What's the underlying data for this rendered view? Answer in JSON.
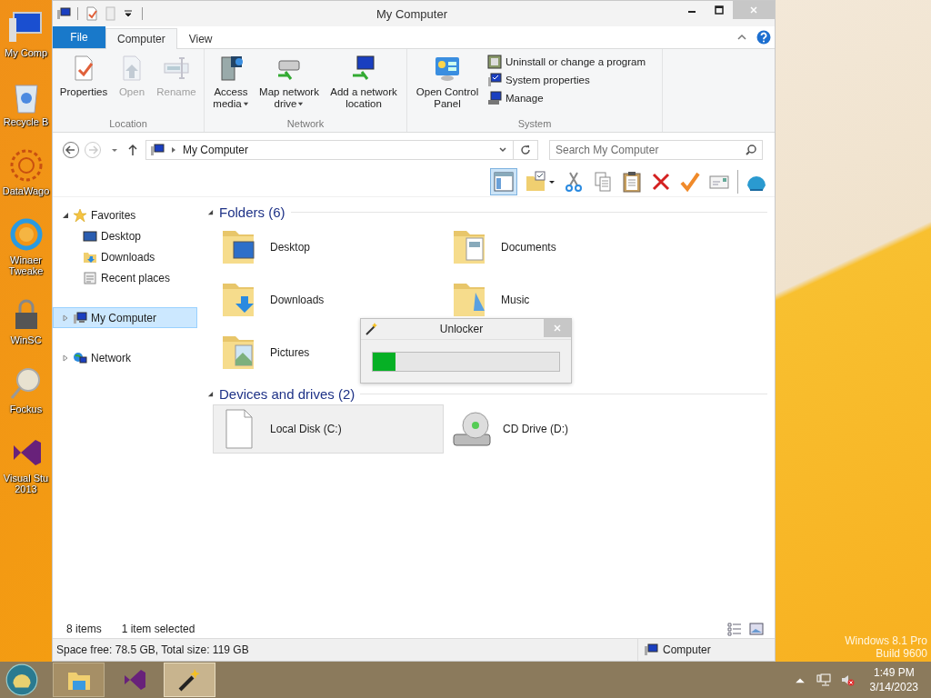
{
  "desktop_icons": [
    {
      "label": "My Comp"
    },
    {
      "label": "Recycle B"
    },
    {
      "label": "DataWago"
    },
    {
      "label": "Winaer Tweake"
    },
    {
      "label": "WinSC"
    },
    {
      "label": "Fockus"
    },
    {
      "label": "Visual Stu 2013"
    }
  ],
  "window": {
    "title": "My Computer"
  },
  "ribbon": {
    "tabs": [
      {
        "label": "File",
        "kind": "file",
        "selected": false
      },
      {
        "label": "Computer",
        "kind": "tab",
        "selected": true
      },
      {
        "label": "View",
        "kind": "tab",
        "selected": false
      }
    ],
    "groups": [
      {
        "label": "Location",
        "buttons": [
          {
            "label": "Properties",
            "disabled": false,
            "dropdown": false
          },
          {
            "label": "Open",
            "disabled": true,
            "dropdown": false
          },
          {
            "label": "Rename",
            "disabled": true,
            "dropdown": false
          }
        ]
      },
      {
        "label": "Network",
        "buttons": [
          {
            "label": "Access media",
            "disabled": false,
            "dropdown": true
          },
          {
            "label": "Map network drive",
            "disabled": false,
            "dropdown": true
          },
          {
            "label": "Add a network location",
            "disabled": false,
            "dropdown": false
          }
        ]
      },
      {
        "label": "System",
        "buttons": [
          {
            "label": "Open Control Panel",
            "disabled": false,
            "dropdown": false
          }
        ],
        "small_buttons": [
          "Uninstall or change a program",
          "System properties",
          "Manage"
        ]
      }
    ]
  },
  "address": {
    "path": "My Computer"
  },
  "search": {
    "placeholder": "Search My Computer"
  },
  "nav": [
    {
      "label": "Favorites",
      "expanded": true,
      "selected": false,
      "children": [
        {
          "label": "Desktop",
          "selected": false
        },
        {
          "label": "Downloads",
          "selected": false
        },
        {
          "label": "Recent places",
          "selected": false
        }
      ]
    },
    {
      "label": "My Computer",
      "expanded": false,
      "selected": true
    },
    {
      "label": "Network",
      "expanded": false,
      "selected": false
    }
  ],
  "sections": [
    {
      "title": "Folders (6)",
      "expanded": true,
      "items": [
        {
          "label": "Desktop",
          "selected": false
        },
        {
          "label": "Documents",
          "selected": false
        },
        {
          "label": "Downloads",
          "selected": false
        },
        {
          "label": "Music",
          "selected": false
        },
        {
          "label": "Pictures",
          "selected": false
        }
      ]
    },
    {
      "title": "Devices and drives (2)",
      "expanded": true,
      "items": [
        {
          "label": "Local Disk (C:)",
          "selected": true
        },
        {
          "label": "CD Drive (D:)",
          "selected": false
        }
      ]
    }
  ],
  "status": {
    "count": "8 items",
    "selection": "1 item selected"
  },
  "details_bar": {
    "space": "Space free: 78.5 GB, Total size: 119 GB",
    "location": "Computer"
  },
  "dialog": {
    "title": "Unlocker",
    "level": 0.12
  },
  "watermark": [
    "Windows 8.1 Pro",
    "Build 9600"
  ],
  "taskbar": {
    "apps": [
      {
        "open": true,
        "selected": false
      },
      {
        "open": false,
        "selected": false
      },
      {
        "open": true,
        "selected": true
      }
    ],
    "time": "1:49 PM",
    "date": "3/14/2023"
  }
}
